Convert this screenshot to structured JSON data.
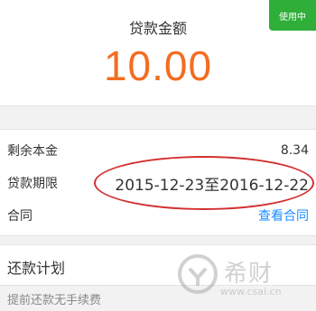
{
  "header": {
    "label": "贷款金额",
    "amount": "10.00",
    "badge": "使用中"
  },
  "details": [
    {
      "label": "剩余本金",
      "value": "8.34"
    },
    {
      "label": "贷款期限",
      "value": "2015-12-23至2016-12-22"
    },
    {
      "label": "合同",
      "value": "查看合同"
    }
  ],
  "plan": {
    "title": "还款计划"
  },
  "footer": {
    "note": "提前还款无手续费"
  },
  "watermark": {
    "text": "希财",
    "url": "www.csai.cn"
  },
  "colors": {
    "amount": "#f36d21",
    "badge": "#2fae3a",
    "link": "#1a8cff",
    "annotation": "#d32f2f"
  }
}
